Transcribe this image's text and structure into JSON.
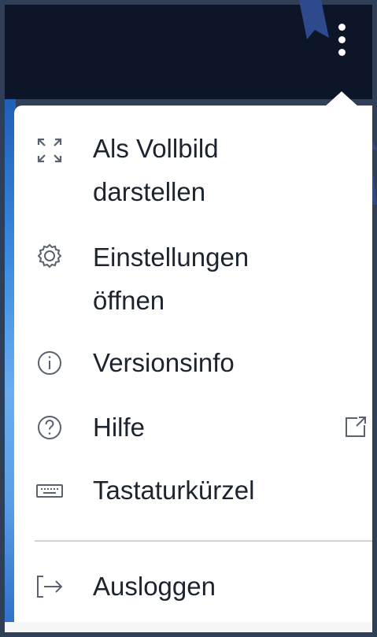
{
  "menu": {
    "items": [
      {
        "id": "fullscreen",
        "label_line1": "Als Vollbild",
        "label_line2": "darstellen",
        "icon": "fullscreen-icon"
      },
      {
        "id": "settings",
        "label_line1": "Einstellungen",
        "label_line2": "öffnen",
        "icon": "gear-icon"
      },
      {
        "id": "version",
        "label_line1": "Versionsinfo",
        "icon": "info-icon"
      },
      {
        "id": "help",
        "label_line1": "Hilfe",
        "icon": "help-icon",
        "trailing_icon": "external-link-icon"
      },
      {
        "id": "shortcuts",
        "label_line1": "Tastaturkürzel",
        "icon": "keyboard-icon"
      },
      {
        "id": "logout",
        "label_line1": "Ausloggen",
        "icon": "logout-icon"
      }
    ]
  },
  "colors": {
    "header": "#0d1629",
    "frame": "#2f3f58",
    "menu_bg": "#ffffff",
    "text": "#1c2430",
    "icon": "#5a6270",
    "arrow": "#2e4a8c"
  }
}
